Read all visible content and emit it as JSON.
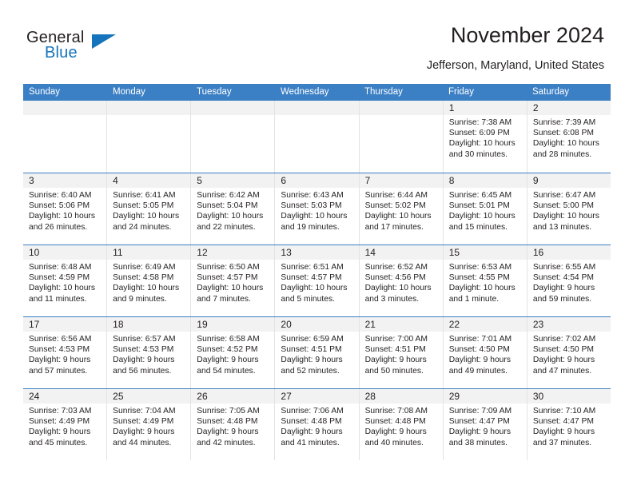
{
  "brand": {
    "name_part1": "General",
    "name_part2": "Blue"
  },
  "header": {
    "title": "November 2024",
    "location": "Jefferson, Maryland, United States"
  },
  "weekdays": [
    "Sunday",
    "Monday",
    "Tuesday",
    "Wednesday",
    "Thursday",
    "Friday",
    "Saturday"
  ],
  "colors": {
    "header_row_bg": "#3b7fc4",
    "day_band_bg": "#f2f2f2",
    "brand_blue": "#1574bb",
    "text": "#231f20",
    "cell_border": "#e3e3e3"
  },
  "weeks": [
    [
      {
        "empty": true
      },
      {
        "empty": true
      },
      {
        "empty": true
      },
      {
        "empty": true
      },
      {
        "empty": true
      },
      {
        "day": "1",
        "sunrise": "Sunrise: 7:38 AM",
        "sunset": "Sunset: 6:09 PM",
        "daylight_1": "Daylight: 10 hours",
        "daylight_2": "and 30 minutes."
      },
      {
        "day": "2",
        "sunrise": "Sunrise: 7:39 AM",
        "sunset": "Sunset: 6:08 PM",
        "daylight_1": "Daylight: 10 hours",
        "daylight_2": "and 28 minutes."
      }
    ],
    [
      {
        "day": "3",
        "sunrise": "Sunrise: 6:40 AM",
        "sunset": "Sunset: 5:06 PM",
        "daylight_1": "Daylight: 10 hours",
        "daylight_2": "and 26 minutes."
      },
      {
        "day": "4",
        "sunrise": "Sunrise: 6:41 AM",
        "sunset": "Sunset: 5:05 PM",
        "daylight_1": "Daylight: 10 hours",
        "daylight_2": "and 24 minutes."
      },
      {
        "day": "5",
        "sunrise": "Sunrise: 6:42 AM",
        "sunset": "Sunset: 5:04 PM",
        "daylight_1": "Daylight: 10 hours",
        "daylight_2": "and 22 minutes."
      },
      {
        "day": "6",
        "sunrise": "Sunrise: 6:43 AM",
        "sunset": "Sunset: 5:03 PM",
        "daylight_1": "Daylight: 10 hours",
        "daylight_2": "and 19 minutes."
      },
      {
        "day": "7",
        "sunrise": "Sunrise: 6:44 AM",
        "sunset": "Sunset: 5:02 PM",
        "daylight_1": "Daylight: 10 hours",
        "daylight_2": "and 17 minutes."
      },
      {
        "day": "8",
        "sunrise": "Sunrise: 6:45 AM",
        "sunset": "Sunset: 5:01 PM",
        "daylight_1": "Daylight: 10 hours",
        "daylight_2": "and 15 minutes."
      },
      {
        "day": "9",
        "sunrise": "Sunrise: 6:47 AM",
        "sunset": "Sunset: 5:00 PM",
        "daylight_1": "Daylight: 10 hours",
        "daylight_2": "and 13 minutes."
      }
    ],
    [
      {
        "day": "10",
        "sunrise": "Sunrise: 6:48 AM",
        "sunset": "Sunset: 4:59 PM",
        "daylight_1": "Daylight: 10 hours",
        "daylight_2": "and 11 minutes."
      },
      {
        "day": "11",
        "sunrise": "Sunrise: 6:49 AM",
        "sunset": "Sunset: 4:58 PM",
        "daylight_1": "Daylight: 10 hours",
        "daylight_2": "and 9 minutes."
      },
      {
        "day": "12",
        "sunrise": "Sunrise: 6:50 AM",
        "sunset": "Sunset: 4:57 PM",
        "daylight_1": "Daylight: 10 hours",
        "daylight_2": "and 7 minutes."
      },
      {
        "day": "13",
        "sunrise": "Sunrise: 6:51 AM",
        "sunset": "Sunset: 4:57 PM",
        "daylight_1": "Daylight: 10 hours",
        "daylight_2": "and 5 minutes."
      },
      {
        "day": "14",
        "sunrise": "Sunrise: 6:52 AM",
        "sunset": "Sunset: 4:56 PM",
        "daylight_1": "Daylight: 10 hours",
        "daylight_2": "and 3 minutes."
      },
      {
        "day": "15",
        "sunrise": "Sunrise: 6:53 AM",
        "sunset": "Sunset: 4:55 PM",
        "daylight_1": "Daylight: 10 hours",
        "daylight_2": "and 1 minute."
      },
      {
        "day": "16",
        "sunrise": "Sunrise: 6:55 AM",
        "sunset": "Sunset: 4:54 PM",
        "daylight_1": "Daylight: 9 hours",
        "daylight_2": "and 59 minutes."
      }
    ],
    [
      {
        "day": "17",
        "sunrise": "Sunrise: 6:56 AM",
        "sunset": "Sunset: 4:53 PM",
        "daylight_1": "Daylight: 9 hours",
        "daylight_2": "and 57 minutes."
      },
      {
        "day": "18",
        "sunrise": "Sunrise: 6:57 AM",
        "sunset": "Sunset: 4:53 PM",
        "daylight_1": "Daylight: 9 hours",
        "daylight_2": "and 56 minutes."
      },
      {
        "day": "19",
        "sunrise": "Sunrise: 6:58 AM",
        "sunset": "Sunset: 4:52 PM",
        "daylight_1": "Daylight: 9 hours",
        "daylight_2": "and 54 minutes."
      },
      {
        "day": "20",
        "sunrise": "Sunrise: 6:59 AM",
        "sunset": "Sunset: 4:51 PM",
        "daylight_1": "Daylight: 9 hours",
        "daylight_2": "and 52 minutes."
      },
      {
        "day": "21",
        "sunrise": "Sunrise: 7:00 AM",
        "sunset": "Sunset: 4:51 PM",
        "daylight_1": "Daylight: 9 hours",
        "daylight_2": "and 50 minutes."
      },
      {
        "day": "22",
        "sunrise": "Sunrise: 7:01 AM",
        "sunset": "Sunset: 4:50 PM",
        "daylight_1": "Daylight: 9 hours",
        "daylight_2": "and 49 minutes."
      },
      {
        "day": "23",
        "sunrise": "Sunrise: 7:02 AM",
        "sunset": "Sunset: 4:50 PM",
        "daylight_1": "Daylight: 9 hours",
        "daylight_2": "and 47 minutes."
      }
    ],
    [
      {
        "day": "24",
        "sunrise": "Sunrise: 7:03 AM",
        "sunset": "Sunset: 4:49 PM",
        "daylight_1": "Daylight: 9 hours",
        "daylight_2": "and 45 minutes."
      },
      {
        "day": "25",
        "sunrise": "Sunrise: 7:04 AM",
        "sunset": "Sunset: 4:49 PM",
        "daylight_1": "Daylight: 9 hours",
        "daylight_2": "and 44 minutes."
      },
      {
        "day": "26",
        "sunrise": "Sunrise: 7:05 AM",
        "sunset": "Sunset: 4:48 PM",
        "daylight_1": "Daylight: 9 hours",
        "daylight_2": "and 42 minutes."
      },
      {
        "day": "27",
        "sunrise": "Sunrise: 7:06 AM",
        "sunset": "Sunset: 4:48 PM",
        "daylight_1": "Daylight: 9 hours",
        "daylight_2": "and 41 minutes."
      },
      {
        "day": "28",
        "sunrise": "Sunrise: 7:08 AM",
        "sunset": "Sunset: 4:48 PM",
        "daylight_1": "Daylight: 9 hours",
        "daylight_2": "and 40 minutes."
      },
      {
        "day": "29",
        "sunrise": "Sunrise: 7:09 AM",
        "sunset": "Sunset: 4:47 PM",
        "daylight_1": "Daylight: 9 hours",
        "daylight_2": "and 38 minutes."
      },
      {
        "day": "30",
        "sunrise": "Sunrise: 7:10 AM",
        "sunset": "Sunset: 4:47 PM",
        "daylight_1": "Daylight: 9 hours",
        "daylight_2": "and 37 minutes."
      }
    ]
  ]
}
